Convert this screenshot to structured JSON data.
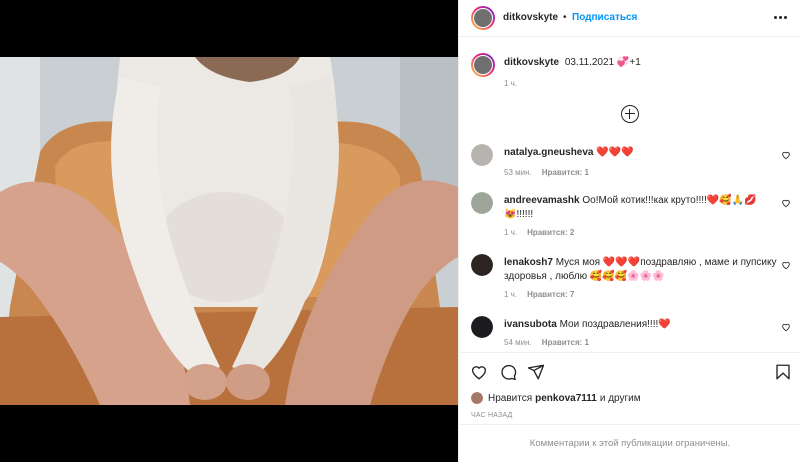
{
  "header": {
    "username": "ditkovskyte",
    "separator": "•",
    "follow_label": "Подписаться",
    "more_icon": "more-horizontal-icon"
  },
  "caption": {
    "username": "ditkovskyte",
    "text": "03.11.2021 💞+1",
    "time": "1 ч."
  },
  "load_more_icon": "plus-circle-icon",
  "comments": [
    {
      "username": "natalya.gneusheva",
      "text": "❤️❤️❤️",
      "time": "53 мин.",
      "likes": "Нравится: 1"
    },
    {
      "username": "andreevamashk",
      "text": "Оо!Мой котик!!!как круто!!!!❤️🥰🙏💋😻!!!!!!",
      "time": "1 ч.",
      "likes": "Нравится: 2"
    },
    {
      "username": "lenakosh7",
      "text": "Муся моя ❤️❤️❤️поздравляю , маме и пупсику здоровья , люблю 🥰🥰🥰🌸🌸🌸",
      "time": "1 ч.",
      "likes": "Нравится: 7"
    },
    {
      "username": "ivansubota",
      "text": "Мои поздравления!!!!❤️",
      "time": "54 мин.",
      "likes": "Нравится: 1"
    }
  ],
  "actions": {
    "like_icon": "heart-icon",
    "comment_icon": "comment-icon",
    "share_icon": "share-icon",
    "save_icon": "bookmark-icon"
  },
  "likes": {
    "prefix": "Нравится",
    "user": "penkova7111",
    "suffix": "и другим"
  },
  "posted_ago": "ЧАС НАЗАД",
  "footer_text": "Комментарии к этой публикации ограничены."
}
